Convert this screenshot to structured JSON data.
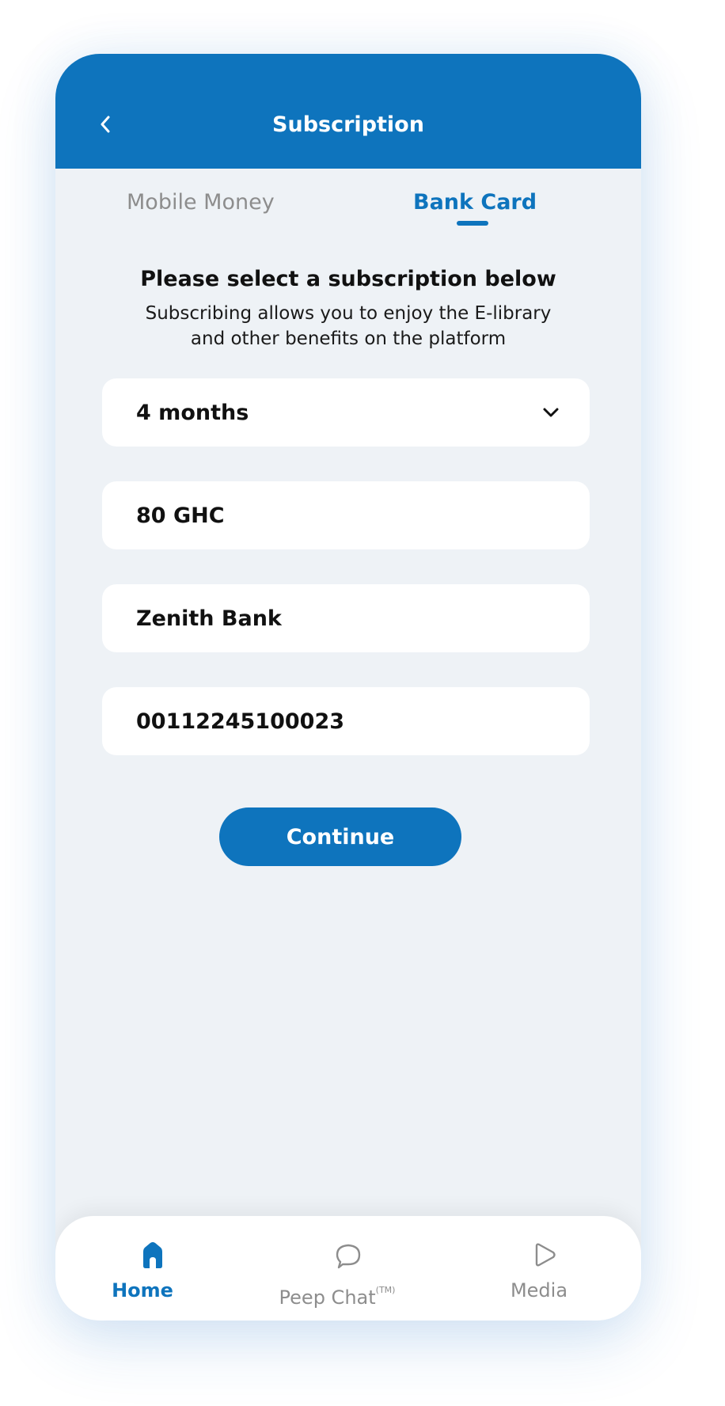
{
  "header": {
    "title": "Subscription",
    "back_icon": "chevron-left-icon"
  },
  "tabs": [
    {
      "label": "Mobile Money",
      "active": false
    },
    {
      "label": "Bank Card",
      "active": true
    }
  ],
  "intro": {
    "title": "Please select a subscription below",
    "subtitle": "Subscribing allows you to enjoy the E-library and other benefits on the platform"
  },
  "form": {
    "duration": "4 months",
    "amount": "80 GHC",
    "bank": "Zenith Bank",
    "account_number": "00112245100023",
    "dropdown_icon": "chevron-down-icon"
  },
  "continue_label": "Continue",
  "nav": {
    "home": {
      "label": "Home",
      "icon": "home-icon",
      "active": true
    },
    "chat": {
      "label": "Peep Chat",
      "trademark": "(TM)",
      "icon": "chat-bubble-icon",
      "active": false
    },
    "media": {
      "label": "Media",
      "icon": "play-icon",
      "active": false
    }
  },
  "colors": {
    "primary": "#0e74bd",
    "background": "#eef2f6",
    "inactive": "#8d8d8d",
    "surface": "#ffffff"
  }
}
